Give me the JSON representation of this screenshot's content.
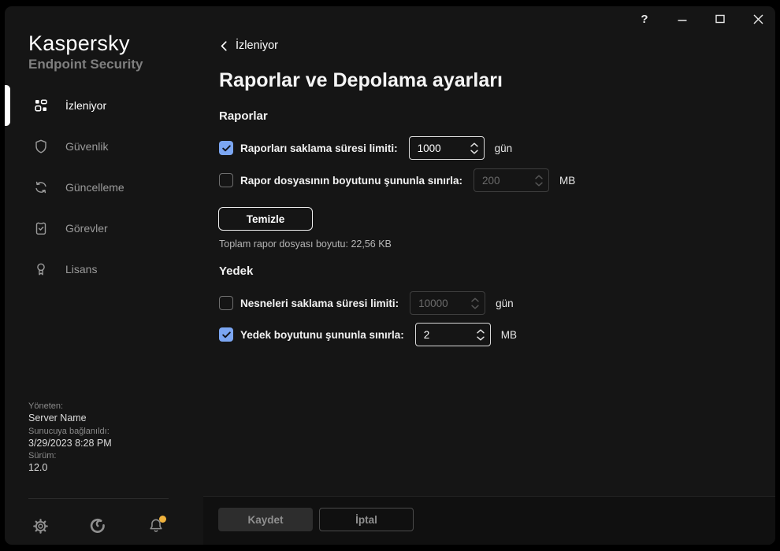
{
  "titlebar": {
    "help_label": "?",
    "buttons": [
      "help",
      "minimize",
      "maximize",
      "close"
    ]
  },
  "sidebar": {
    "brand": {
      "name": "Kaspersky",
      "product": "Endpoint Security"
    },
    "items": [
      {
        "label": "İzleniyor",
        "icon": "dashboard-icon",
        "active": true
      },
      {
        "label": "Güvenlik",
        "icon": "shield-icon",
        "active": false
      },
      {
        "label": "Güncelleme",
        "icon": "refresh-icon",
        "active": false
      },
      {
        "label": "Görevler",
        "icon": "tasks-icon",
        "active": false
      },
      {
        "label": "Lisans",
        "icon": "license-icon",
        "active": false
      }
    ],
    "server_info": [
      {
        "label": "Yöneten:",
        "value": "Server Name"
      },
      {
        "label": "Sunucuya bağlanıldı:",
        "value": "3/29/2023 8:28 PM"
      },
      {
        "label": "Sürüm:",
        "value": "12.0"
      }
    ],
    "footer_icons": [
      "gear-icon",
      "support-icon",
      "bell-icon"
    ],
    "bell_has_notification": true
  },
  "main": {
    "breadcrumb": "İzleniyor",
    "title": "Raporlar ve Depolama ayarları",
    "sections": [
      {
        "heading": "Raporlar",
        "rows": [
          {
            "label": "Raporları saklama süresi limiti:",
            "checked": true,
            "value": "1000",
            "unit": "gün",
            "enabled": true
          },
          {
            "label": "Rapor dosyasının boyutunu şununla sınırla:",
            "checked": false,
            "value": "200",
            "unit": "MB",
            "enabled": false
          }
        ],
        "clear_button": "Temizle",
        "note": "Toplam rapor dosyası boyutu: 22,56 KB"
      },
      {
        "heading": "Yedek",
        "rows": [
          {
            "label": "Nesneleri saklama süresi limiti:",
            "checked": false,
            "value": "10000",
            "unit": "gün",
            "enabled": false
          },
          {
            "label": "Yedek boyutunu şununla sınırla:",
            "checked": true,
            "value": "2",
            "unit": "MB",
            "enabled": true
          }
        ]
      }
    ],
    "footer": {
      "save_label": "Kaydet",
      "cancel_label": "İptal"
    }
  },
  "colors": {
    "window_bg": "#151515",
    "checkbox_accent": "#7ba6f2",
    "notification_dot": "#efb23d",
    "active_indicator": "#ffffff"
  }
}
